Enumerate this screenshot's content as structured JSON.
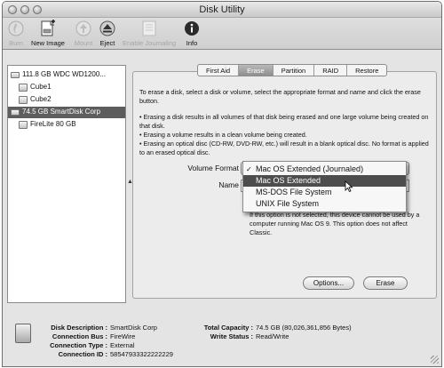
{
  "window": {
    "title": "Disk Utility"
  },
  "toolbar": {
    "items": [
      {
        "label": "Burn",
        "icon": "burn-icon",
        "enabled": false
      },
      {
        "label": "New Image",
        "icon": "new-image-icon",
        "enabled": true
      },
      {
        "label": "Mount",
        "icon": "mount-icon",
        "enabled": false
      },
      {
        "label": "Eject",
        "icon": "eject-icon",
        "enabled": true
      },
      {
        "label": "Enable Journaling",
        "icon": "journaling-icon",
        "enabled": false
      },
      {
        "label": "Info",
        "icon": "info-icon",
        "enabled": true
      }
    ]
  },
  "sidebar": {
    "items": [
      {
        "label": "111.8 GB WDC WD1200...",
        "icon": "hard-drive-icon"
      },
      {
        "label": "Cube1",
        "icon": "volume-icon"
      },
      {
        "label": "Cube2",
        "icon": "volume-icon"
      },
      {
        "label": "74.5 GB SmartDisk Corp",
        "icon": "hard-drive-icon",
        "selected": true
      },
      {
        "label": "FireLite 80 GB",
        "icon": "volume-icon"
      }
    ]
  },
  "tabs": [
    "First Aid",
    "Erase",
    "Partition",
    "RAID",
    "Restore"
  ],
  "active_tab": "Erase",
  "erase": {
    "intro": "To erase a disk, select a disk or volume, select the appropriate format and name and click the erase button.",
    "bullets": [
      "• Erasing a disk results in all volumes of that disk being erased and one large volume being created on that disk.",
      "• Erasing a volume results in a clean volume being created.",
      "• Erasing an optical disc (CD-RW, DVD-RW, etc.) will result in a blank optical disc. No format is applied to an erased optical disc."
    ],
    "volume_format_label": "Volume Format",
    "name_label": "Name",
    "format_options": [
      {
        "label": "Mac OS Extended (Journaled)",
        "checked": true
      },
      {
        "label": "Mac OS Extended",
        "highlighted": true
      },
      {
        "label": "MS-DOS File System"
      },
      {
        "label": "UNIX File System"
      }
    ],
    "note": "If this option is not selected, this device cannot be used by a computer running Mac OS 9. This option does not affect Classic.",
    "options_button": "Options...",
    "erase_button": "Erase"
  },
  "info": {
    "disk_description_label": "Disk Description :",
    "disk_description": "SmartDisk Corp",
    "connection_bus_label": "Connection Bus :",
    "connection_bus": "FireWire",
    "connection_type_label": "Connection Type :",
    "connection_type": "External",
    "connection_id_label": "Connection ID :",
    "connection_id": "58547933322222229",
    "total_capacity_label": "Total Capacity :",
    "total_capacity": "74.5 GB (80,026,361,856 Bytes)",
    "write_status_label": "Write Status :",
    "write_status": "Read/Write"
  },
  "colors": {
    "selection": "#5d5d5d",
    "menu_highlight": "#4d4d4d",
    "window_bg": "#e4e4e4"
  }
}
